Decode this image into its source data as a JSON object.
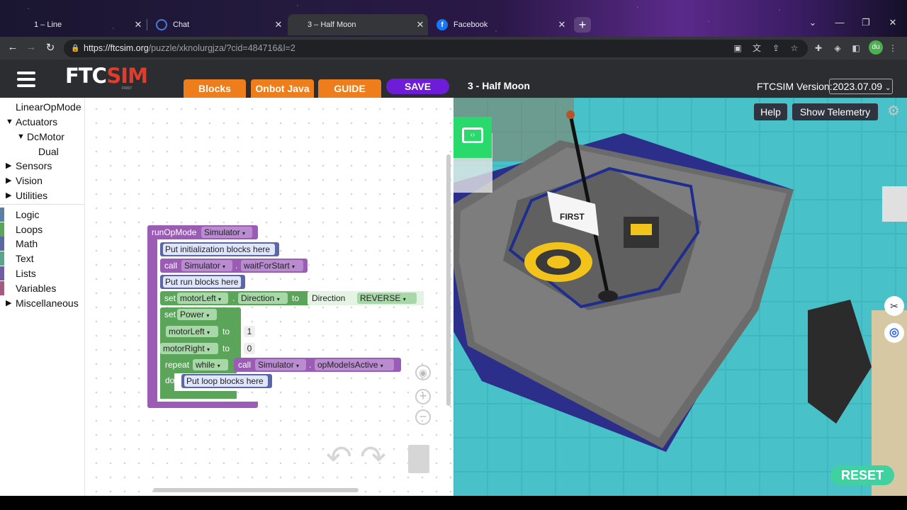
{
  "browser": {
    "tabs": [
      {
        "title": "1 – Line",
        "active": false
      },
      {
        "title": "Chat",
        "active": false
      },
      {
        "title": "3 – Half Moon",
        "active": true
      },
      {
        "title": "Facebook",
        "active": false
      }
    ],
    "url_host": "https://ftcsim.org",
    "url_path": "/puzzle/xknolurgjza/?cid=484716&l=2",
    "profile_initials": "du"
  },
  "header": {
    "logo_a": "FTC",
    "logo_b": "SIM",
    "logo_sub": "FIRST",
    "tabs": [
      "Blocks",
      "Onbot Java",
      "GUIDE"
    ],
    "save_label": "SAVE",
    "page_title": "3 - Half Moon",
    "version_label": "FTCSIM Version:",
    "version_value": "2023.07.09"
  },
  "toolbox": {
    "items": [
      {
        "label": "LinearOpMode",
        "color": "#ffffff"
      },
      {
        "label": "Actuators",
        "color": "#ffffff"
      },
      {
        "label": "DcMotor",
        "color": "#ffffff"
      },
      {
        "label": "Dual",
        "color": "#ffffff"
      },
      {
        "label": "Sensors",
        "color": "#ffffff"
      },
      {
        "label": "Vision",
        "color": "#ffffff"
      },
      {
        "label": "Utilities",
        "color": "#ffffff"
      },
      {
        "label": "Logic",
        "color": "#5b80a5"
      },
      {
        "label": "Loops",
        "color": "#5ba55b"
      },
      {
        "label": "Math",
        "color": "#5b67a5"
      },
      {
        "label": "Text",
        "color": "#5ba58c"
      },
      {
        "label": "Lists",
        "color": "#745ba5"
      },
      {
        "label": "Variables",
        "color": "#a55b80"
      },
      {
        "label": "Miscellaneous",
        "color": "#ffffff"
      }
    ]
  },
  "blocks": {
    "run_op_mode": "runOpMode",
    "simulator": "Simulator",
    "init_comment": "Put initialization blocks here",
    "call": "call",
    "wait_for_start": "waitForStart",
    "run_comment": "Put run blocks here",
    "set": "set",
    "motor_left": "motorLeft",
    "direction_prop": "Direction",
    "to": "to",
    "direction_enum": "Direction",
    "reverse": "REVERSE",
    "power": "Power",
    "value_1": "1",
    "motor_right": "motorRight",
    "value_0": "0",
    "repeat": "repeat",
    "while": "while",
    "op_mode_is_active": "opModeIsActive",
    "do": "do",
    "loop_comment": "Put loop blocks here"
  },
  "simulator": {
    "help_label": "Help",
    "telemetry_label": "Show Telemetry",
    "reset_label": "RESET",
    "flag_text": "FIRST"
  }
}
